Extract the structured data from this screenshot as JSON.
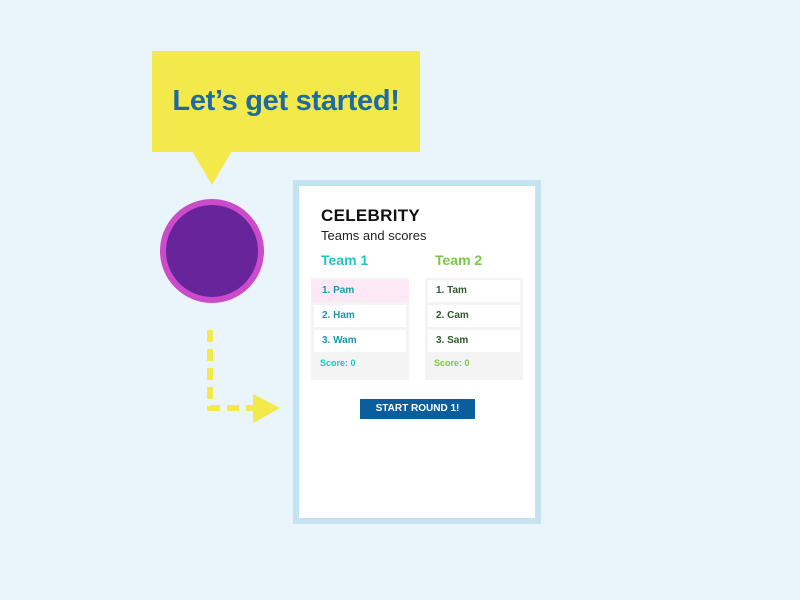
{
  "bubble": {
    "text": "Let’s get started!"
  },
  "card": {
    "title": "CELEBRITY",
    "subtitle": "Teams and scores",
    "teams": [
      {
        "name": "Team 1",
        "players": [
          "1. Pam",
          "2. Ham",
          "3. Wam"
        ],
        "score": "Score: 0",
        "color": "#1ec6c7"
      },
      {
        "name": "Team 2",
        "players": [
          "1. Tam",
          "2. Cam",
          "3. Sam"
        ],
        "score": "Score: 0",
        "color": "#7ac943"
      }
    ],
    "start_button": "START ROUND 1!"
  },
  "colors": {
    "background": "#eaf4fb",
    "bubble": "#f3e94a",
    "bubble_text": "#1e6aa2",
    "avatar_fill": "#68249a",
    "avatar_ring": "#cb4ccb",
    "card_border": "#c4e3f0",
    "button": "#0a5e9e",
    "highlight_row": "#fde8f6"
  },
  "icons": {
    "avatar": "avatar-circle",
    "arrow": "dashed-arrow-right-icon"
  }
}
